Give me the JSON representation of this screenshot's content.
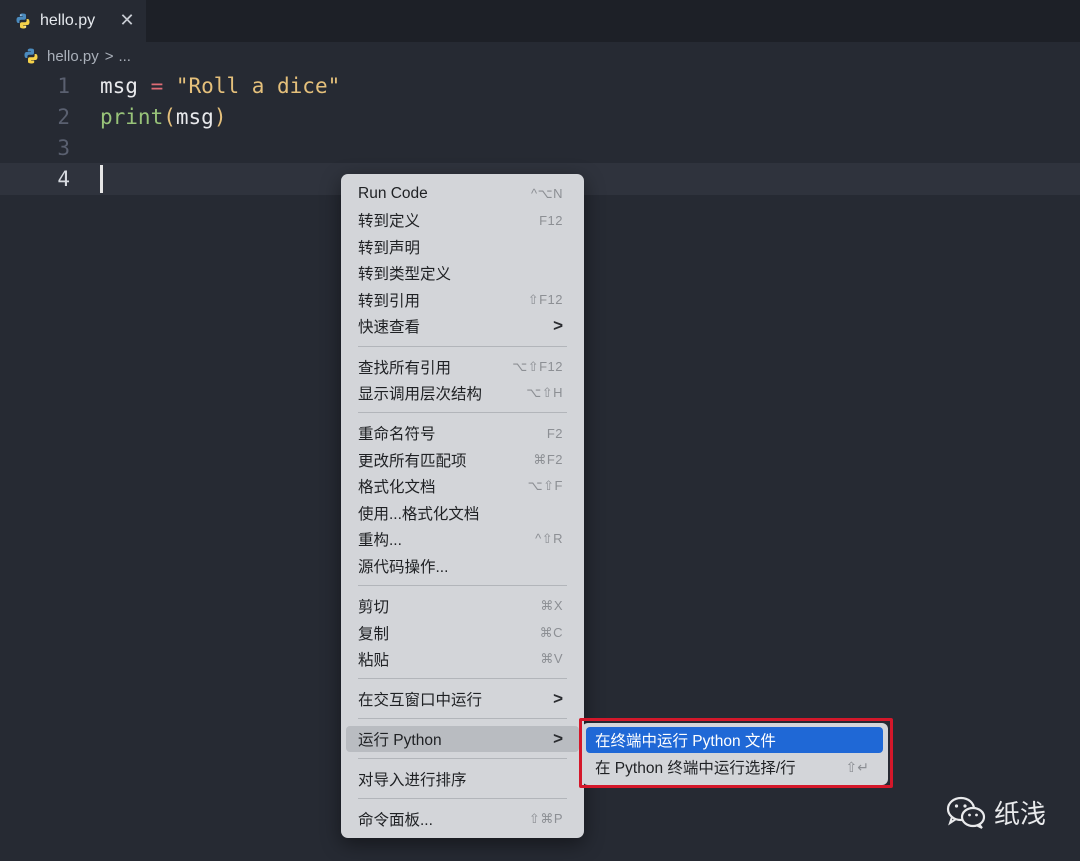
{
  "tab": {
    "label": "hello.py",
    "close": "✕"
  },
  "breadcrumb": {
    "file": "hello.py",
    "sep": ">",
    "more": "..."
  },
  "editor": {
    "lines": [
      {
        "num": "1",
        "tokens": [
          "msg",
          " = ",
          "\"Roll a dice\""
        ]
      },
      {
        "num": "2",
        "tokens": [
          "print",
          "(",
          "msg",
          ")"
        ]
      },
      {
        "num": "3"
      },
      {
        "num": "4"
      }
    ]
  },
  "context_menu": {
    "items": [
      {
        "label": "Run Code",
        "shortcut": "^⌥N"
      },
      {
        "label": "转到定义",
        "shortcut": "F12"
      },
      {
        "label": "转到声明",
        "shortcut": ""
      },
      {
        "label": "转到类型定义",
        "shortcut": ""
      },
      {
        "label": "转到引用",
        "shortcut": "⇧F12"
      },
      {
        "label": "快速查看",
        "submenu": ">"
      },
      {
        "label": "查找所有引用",
        "shortcut": "⌥⇧F12"
      },
      {
        "label": "显示调用层次结构",
        "shortcut": "⌥⇧H"
      },
      {
        "label": "重命名符号",
        "shortcut": "F2"
      },
      {
        "label": "更改所有匹配项",
        "shortcut": "⌘F2"
      },
      {
        "label": "格式化文档",
        "shortcut": "⌥⇧F"
      },
      {
        "label": "使用...格式化文档",
        "shortcut": ""
      },
      {
        "label": "重构...",
        "shortcut": "^⇧R"
      },
      {
        "label": "源代码操作...",
        "shortcut": ""
      },
      {
        "label": "剪切",
        "shortcut": "⌘X"
      },
      {
        "label": "复制",
        "shortcut": "⌘C"
      },
      {
        "label": "粘贴",
        "shortcut": "⌘V"
      },
      {
        "label": "在交互窗口中运行",
        "submenu": ">"
      },
      {
        "label": "运行 Python",
        "submenu": ">"
      },
      {
        "label": "对导入进行排序",
        "shortcut": ""
      },
      {
        "label": "命令面板...",
        "shortcut": "⇧⌘P"
      }
    ]
  },
  "submenu": {
    "items": [
      {
        "label": "在终端中运行 Python 文件",
        "shortcut": ""
      },
      {
        "label": "在 Python 终端中运行选择/行",
        "shortcut": "⇧↵"
      }
    ]
  },
  "watermark": {
    "text": "纸浅"
  },
  "colors": {
    "editor_bg": "#262a33",
    "menu_bg": "#d3d5d9",
    "selection": "#1f68d6",
    "highlight_box": "#d4172a"
  }
}
